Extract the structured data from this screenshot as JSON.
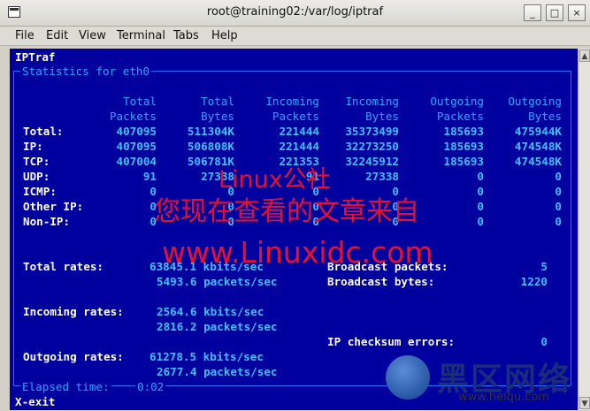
{
  "window": {
    "title": "root@training02:/var/log/iptraf",
    "min_label": "_",
    "max_label": "□",
    "close_label": "×"
  },
  "menu": [
    "File",
    "Edit",
    "View",
    "Terminal",
    "Tabs",
    "Help"
  ],
  "app": {
    "name": "IPTraf",
    "section_title": "Statistics for eth0",
    "headers": [
      [
        "Total",
        "Packets"
      ],
      [
        "Total",
        "Bytes"
      ],
      [
        "Incoming",
        "Packets"
      ],
      [
        "Incoming",
        "Bytes"
      ],
      [
        "Outgoing",
        "Packets"
      ],
      [
        "Outgoing",
        "Bytes"
      ]
    ],
    "rows": [
      {
        "label": "Total:",
        "values": [
          "407095",
          "511304K",
          "221444",
          "35373499",
          "185693",
          "475944K"
        ]
      },
      {
        "label": "IP:",
        "values": [
          "407095",
          "506808K",
          "221444",
          "32273250",
          "185693",
          "474548K"
        ]
      },
      {
        "label": "TCP:",
        "values": [
          "407004",
          "506781K",
          "221353",
          "32245912",
          "185693",
          "474548K"
        ]
      },
      {
        "label": "UDP:",
        "values": [
          "91",
          "27338",
          "91",
          "27338",
          "0",
          "0"
        ]
      },
      {
        "label": "ICMP:",
        "values": [
          "0",
          "0",
          "0",
          "0",
          "0",
          "0"
        ]
      },
      {
        "label": "Other IP:",
        "values": [
          "0",
          "0",
          "0",
          "0",
          "0",
          "0"
        ]
      },
      {
        "label": "Non-IP:",
        "values": [
          "0",
          "0",
          "0",
          "0",
          "0",
          "0"
        ]
      }
    ],
    "rates": {
      "total_label": "Total rates:",
      "total_kbits": "63845.1 kbits/sec",
      "total_packets": "5493.6 packets/sec",
      "incoming_label": "Incoming rates:",
      "incoming_kbits": "2564.6 kbits/sec",
      "incoming_packets": "2816.2 packets/sec",
      "outgoing_label": "Outgoing rates:",
      "outgoing_kbits": "61278.5 kbits/sec",
      "outgoing_packets": "2677.4 packets/sec"
    },
    "broadcast_packets_label": "Broadcast packets:",
    "broadcast_packets_value": "5",
    "broadcast_bytes_label": "Broadcast bytes:",
    "broadcast_bytes_value": "1220",
    "checksum_label": "IP checksum errors:",
    "checksum_value": "0",
    "elapsed_label": "Elapsed time:",
    "elapsed_value": "0:02",
    "exit_key": "X",
    "exit_label": "-exit"
  },
  "watermark": {
    "line1": "Linux公社",
    "line2": "您现在查看的文章来自",
    "line3": "www.Linuxidc.com"
  },
  "logo": {
    "cn": "黑区网络",
    "url": "www.heiqu.com"
  }
}
